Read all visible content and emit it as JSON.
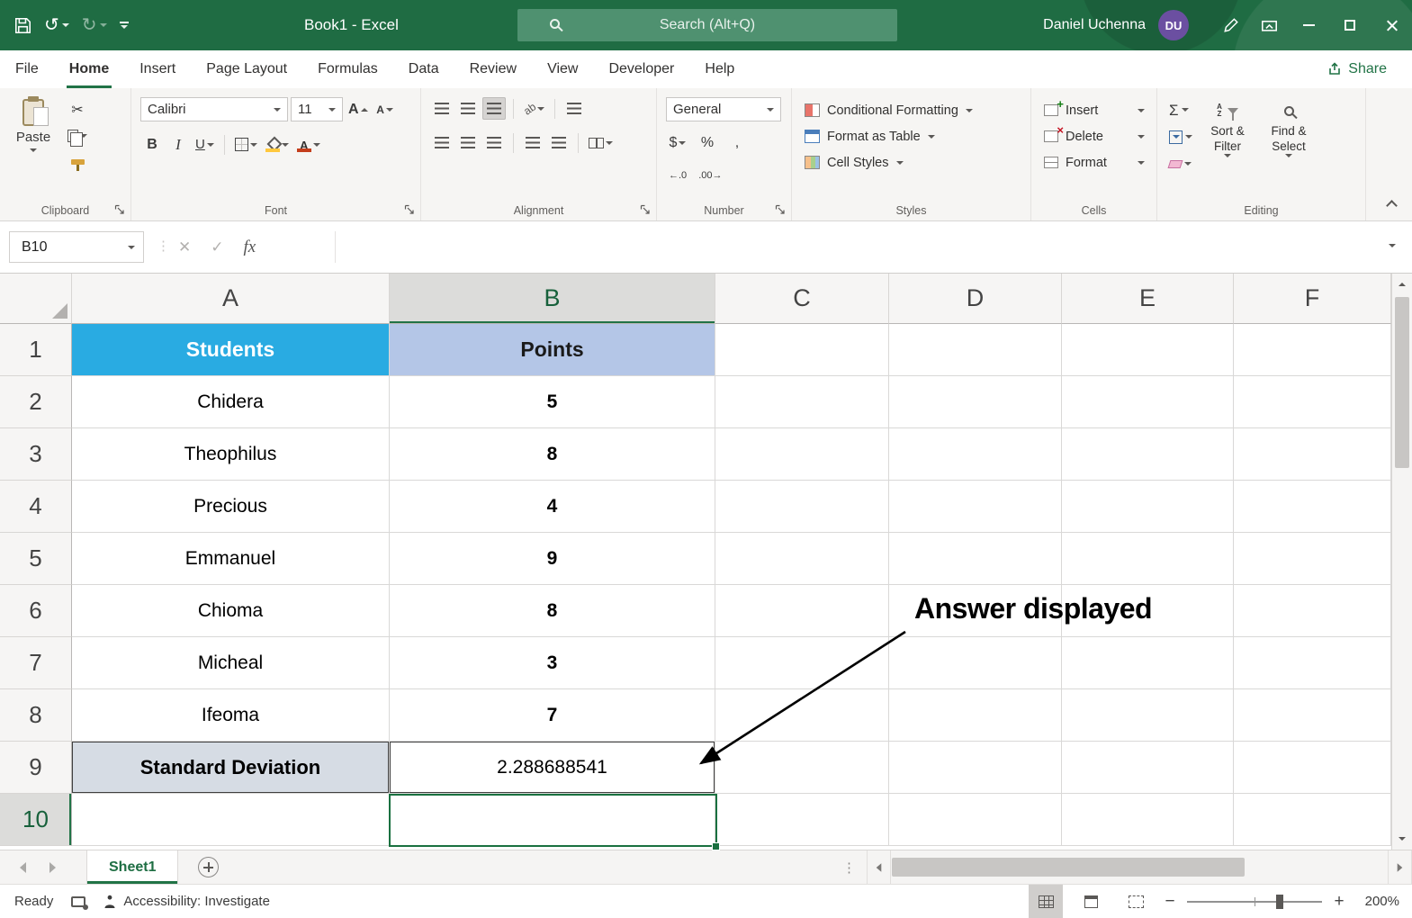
{
  "title_bar": {
    "title": "Book1 - Excel",
    "search_placeholder": "Search (Alt+Q)",
    "user_name": "Daniel Uchenna",
    "user_initials": "DU",
    "undo_glyph": "↺",
    "redo_glyph": "↻"
  },
  "menu": {
    "tabs": [
      "File",
      "Home",
      "Insert",
      "Page Layout",
      "Formulas",
      "Data",
      "Review",
      "View",
      "Developer",
      "Help"
    ],
    "share": "Share"
  },
  "ribbon": {
    "clipboard": {
      "label": "Clipboard",
      "paste": "Paste",
      "cut_glyph": "✂"
    },
    "font": {
      "label": "Font",
      "family": "Calibri",
      "size": "11",
      "bold": "B",
      "italic": "I",
      "underline": "U"
    },
    "alignment": {
      "label": "Alignment"
    },
    "number": {
      "label": "Number",
      "format": "General",
      "currency": "$",
      "percent": "%",
      "comma": ",",
      "inc_decimal": "←.0",
      "dec_decimal": ".00→"
    },
    "styles": {
      "label": "Styles",
      "conditional": "Conditional Formatting",
      "format_table": "Format as Table",
      "cell_styles": "Cell Styles"
    },
    "cells": {
      "label": "Cells",
      "insert": "Insert",
      "delete": "Delete",
      "format": "Format"
    },
    "editing": {
      "label": "Editing",
      "autosum": "Σ",
      "sort_filter": "Sort & Filter",
      "find_select": "Find & Select"
    }
  },
  "formula_bar": {
    "name_box": "B10",
    "cancel": "✕",
    "enter": "✓",
    "fx": "fx",
    "formula": ""
  },
  "sheet": {
    "cols": [
      "A",
      "B",
      "C",
      "D",
      "E",
      "F"
    ],
    "rows": [
      "1",
      "2",
      "3",
      "4",
      "5",
      "6",
      "7",
      "8",
      "9",
      "10"
    ],
    "cells": {
      "A1": "Students",
      "B1": "Points",
      "A2": "Chidera",
      "B2": "5",
      "A3": "Theophilus",
      "B3": "8",
      "A4": "Precious",
      "B4": "4",
      "A5": "Emmanuel",
      "B5": "9",
      "A6": "Chioma",
      "B6": "8",
      "A7": "Micheal",
      "B7": "3",
      "A8": "Ifeoma",
      "B8": "7",
      "A9": "Standard Deviation",
      "B9": "2.288688541"
    },
    "selected_cell": "B10"
  },
  "annotation": {
    "text": "Answer displayed"
  },
  "sheet_tabs": {
    "active": "Sheet1"
  },
  "status_bar": {
    "mode": "Ready",
    "accessibility": "Accessibility: Investigate",
    "zoom_out": "−",
    "zoom_in": "+",
    "zoom_level": "200%"
  },
  "colors": {
    "accent_green": "#217346",
    "titlebar_green": "#1F6C43",
    "students_fill": "#29ABE2",
    "points_fill": "#B4C6E7",
    "stdev_fill": "#D6DCE4",
    "avatar": "#6B4FA1"
  }
}
